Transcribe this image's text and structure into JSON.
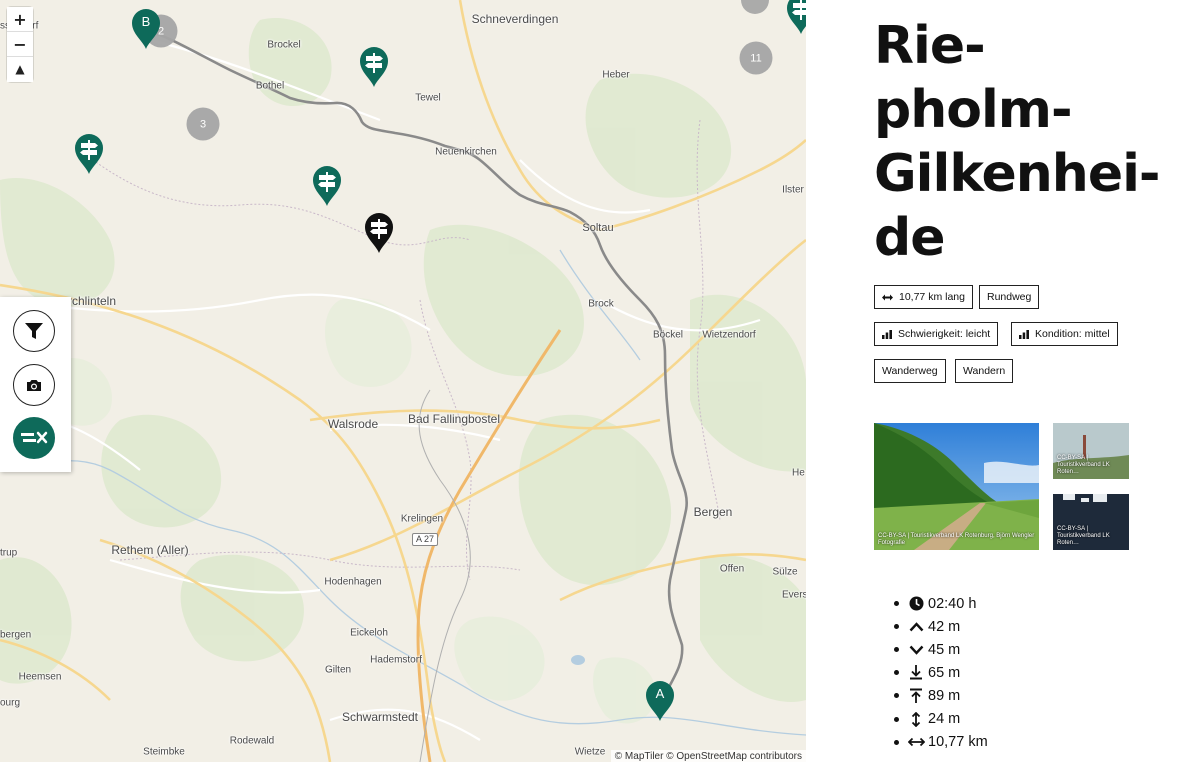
{
  "map": {
    "controls": {
      "zoom_in": "+",
      "zoom_out": "−",
      "reset_bearing": "▲"
    },
    "places": [
      {
        "name": "Schneverdingen",
        "size": "l"
      },
      {
        "name": "Brockel",
        "size": "s"
      },
      {
        "name": "Heber",
        "size": "s"
      },
      {
        "name": "Bothel",
        "size": "s"
      },
      {
        "name": "Tewel",
        "size": "s"
      },
      {
        "name": "Neuenkirchen",
        "size": "s"
      },
      {
        "name": "Soltau",
        "size": "m"
      },
      {
        "name": "Ilster",
        "size": "s"
      },
      {
        "name": "Brock",
        "size": "s"
      },
      {
        "name": "Böckel",
        "size": "s"
      },
      {
        "name": "Wietzendorf",
        "size": "s"
      },
      {
        "name": "Walsrode",
        "size": "l"
      },
      {
        "name": "Bad Fallingbostel",
        "size": "l"
      },
      {
        "name": "Krelingen",
        "size": "s"
      },
      {
        "name": "Bergen",
        "size": "l"
      },
      {
        "name": "Rethem (Aller)",
        "size": "l"
      },
      {
        "name": "Offen",
        "size": "s"
      },
      {
        "name": "Sülze",
        "size": "s"
      },
      {
        "name": "Hodenhagen",
        "size": "s"
      },
      {
        "name": "Eickeloh",
        "size": "s"
      },
      {
        "name": "Gilten",
        "size": "s"
      },
      {
        "name": "Hademstorf",
        "size": "s"
      },
      {
        "name": "Schwarmstedt",
        "size": "l"
      },
      {
        "name": "Rodewald",
        "size": "s"
      },
      {
        "name": "Steimbke",
        "size": "s"
      },
      {
        "name": "Wietze",
        "size": "s"
      },
      {
        "name": "Heemsen",
        "size": "s"
      },
      {
        "name": "rchlinteln",
        "size": "l"
      },
      {
        "name": "ssendorf",
        "size": "s"
      },
      {
        "name": "trup",
        "size": "s"
      },
      {
        "name": "bergen",
        "size": "s"
      },
      {
        "name": "ourg",
        "size": "s"
      },
      {
        "name": "He",
        "size": "s"
      },
      {
        "name": "Evers",
        "size": "s"
      }
    ],
    "road_shield": "A 27",
    "clusters": [
      "2",
      "3",
      "11"
    ],
    "route_markers": {
      "start": "A",
      "end": "B"
    },
    "attribution": "© MapTiler © OpenStreetMap contributors",
    "tools": [
      "filter-icon",
      "camera-icon",
      "signpost-close-icon"
    ],
    "colors": {
      "pin": "#0e6a5a",
      "active_pin": "#111111",
      "route": "#8a8a8a",
      "cluster": "#a6a6a6"
    }
  },
  "panel": {
    "title_lines": [
      "Rie-",
      "pholm-",
      "Gilkenhei-",
      "de"
    ],
    "tags": {
      "length": "10,77 km lang",
      "type": "Rundweg",
      "difficulty": "Schwierigkeit: leicht",
      "condition": "Kondition: mittel",
      "category1": "Wanderweg",
      "category2": "Wandern"
    },
    "photos": [
      {
        "caption": "CC-BY-SA | Touristikverband LK Rotenburg, Björn Wengler Fotografie"
      },
      {
        "caption": "CC-BY-SA | Touristikverband LK Roten…"
      },
      {
        "caption": "CC-BY-SA | Touristikverband LK Roten…"
      }
    ],
    "stats": [
      {
        "icon": "clock-icon",
        "value": "02:40 h"
      },
      {
        "icon": "ascent-icon",
        "value": "42 m"
      },
      {
        "icon": "descent-icon",
        "value": "45 m"
      },
      {
        "icon": "lowest-point-icon",
        "value": "65 m"
      },
      {
        "icon": "highest-point-icon",
        "value": "89 m"
      },
      {
        "icon": "elevation-difference-icon",
        "value": "24 m"
      },
      {
        "icon": "distance-icon",
        "value": "10,77 km"
      }
    ]
  }
}
